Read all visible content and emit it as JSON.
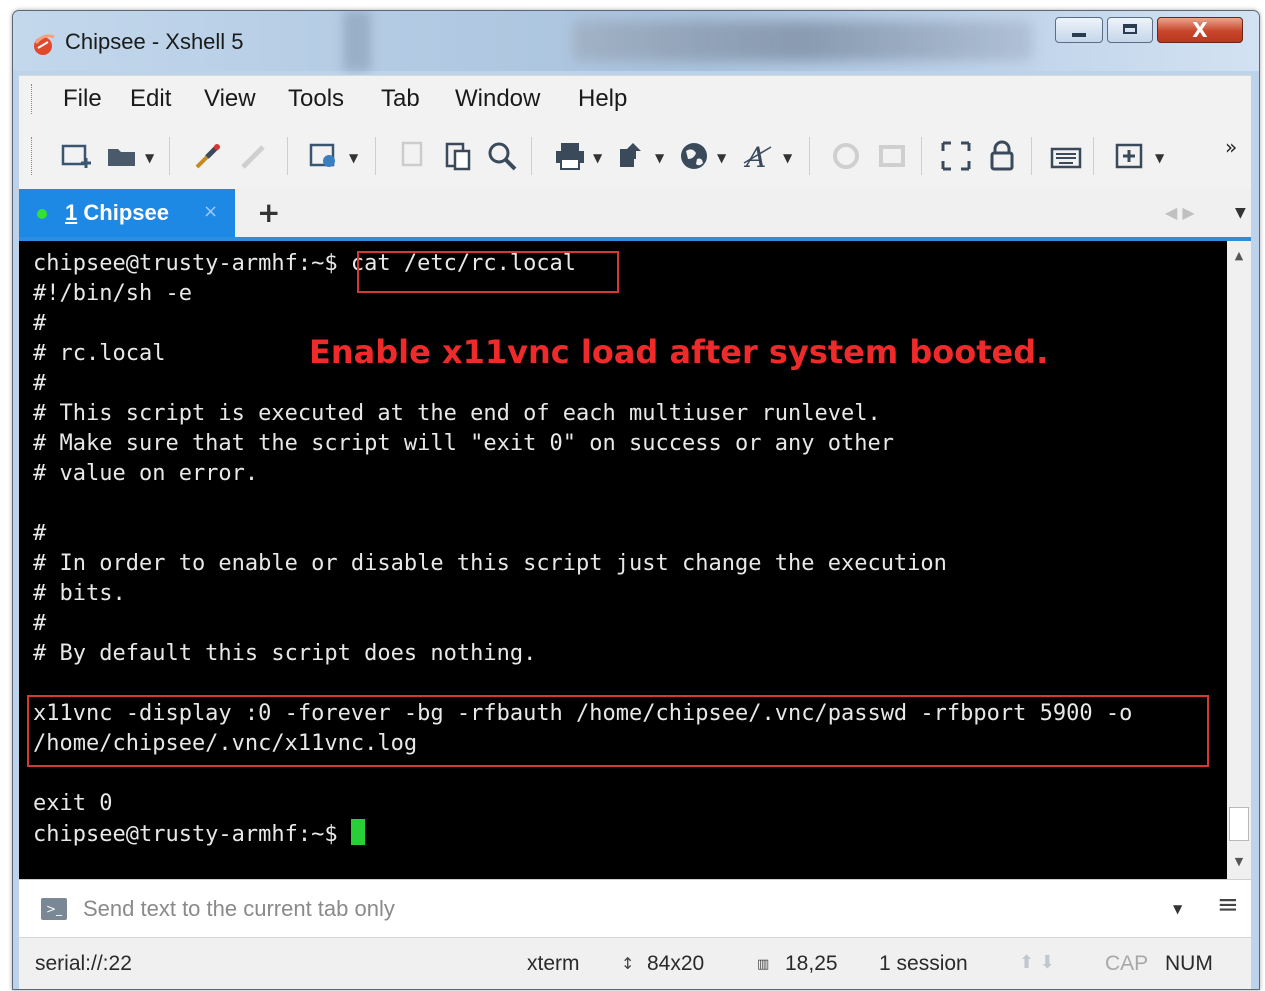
{
  "window": {
    "title": "Chipsee - Xshell 5",
    "close_glyph": "X"
  },
  "menu": [
    {
      "label": "File"
    },
    {
      "label": "Edit"
    },
    {
      "label": "View"
    },
    {
      "label": "Tools"
    },
    {
      "label": "Tab"
    },
    {
      "label": "Window"
    },
    {
      "label": "Help"
    }
  ],
  "toolbar": {
    "icons": [
      "new-session",
      "open-folder",
      "connect",
      "disconnect",
      "properties",
      "copy",
      "paste",
      "find",
      "print",
      "transfer",
      "globe",
      "font",
      "script",
      "record",
      "fullscreen",
      "lock",
      "keyboard",
      "add"
    ],
    "more_glyph": "»"
  },
  "tabs": {
    "active": {
      "number": "1",
      "label": "Chipsee",
      "status": "connected"
    },
    "close_glyph": "×",
    "add_glyph": "+"
  },
  "terminal": {
    "lines": [
      "chipsee@trusty-armhf:~$ cat /etc/rc.local",
      "#!/bin/sh -e",
      "#",
      "# rc.local",
      "#",
      "# This script is executed at the end of each multiuser runlevel.",
      "# Make sure that the script will \"exit 0\" on success or any other",
      "# value on error.",
      "",
      "#",
      "# In order to enable or disable this script just change the execution",
      "# bits.",
      "#",
      "# By default this script does nothing.",
      "",
      "x11vnc -display :0 -forever -bg -rfbauth /home/chipsee/.vnc/passwd -rfbport 5900 -o",
      "/home/chipsee/.vnc/x11vnc.log",
      "",
      "exit 0"
    ],
    "prompt": "chipsee@trusty-armhf:~$ ",
    "annotation": "Enable x11vnc load after system booted.",
    "colors": {
      "background": "#000000",
      "text": "#e8e8e8",
      "cursor": "#26d036",
      "annotation": "#ee2a2a",
      "highlight_border": "#d43a35"
    }
  },
  "sendbar": {
    "placeholder": "Send text to the current tab only"
  },
  "status": {
    "connection": "serial://:22",
    "terminal_type": "xterm",
    "size": "84x20",
    "cursor_pos": "18,25",
    "sessions": "1 session",
    "cap": "CAP",
    "num": "NUM"
  }
}
